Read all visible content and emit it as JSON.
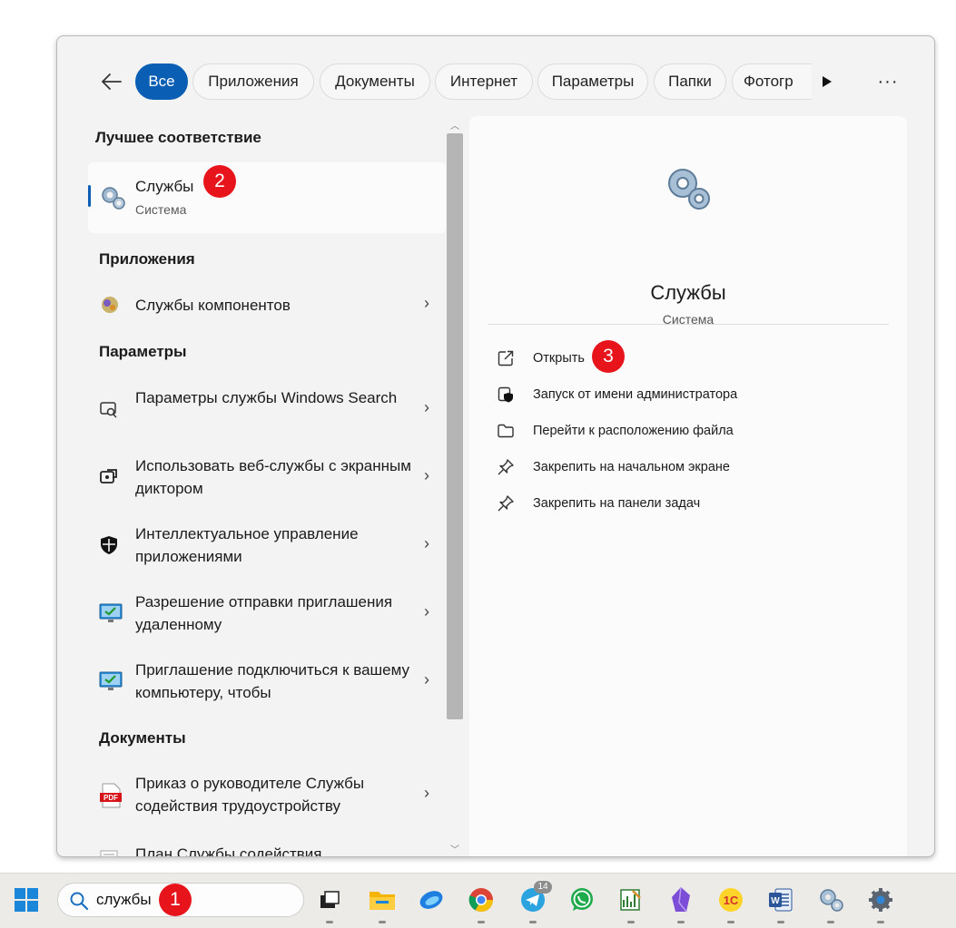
{
  "tabs": [
    "Все",
    "Приложения",
    "Документы",
    "Интернет",
    "Параметры",
    "Папки",
    "Фотогр"
  ],
  "more_label": "···",
  "best_match": {
    "heading": "Лучшее соответствие",
    "title": "Службы",
    "subtitle": "Система"
  },
  "apps": {
    "heading": "Приложения",
    "items": [
      {
        "label": "Службы компонентов"
      }
    ]
  },
  "settings": {
    "heading": "Параметры",
    "items": [
      {
        "label": "Параметры службы Windows Search"
      },
      {
        "label": "Использовать веб-службы с экранным диктором"
      },
      {
        "label": "Интеллектуальное управление приложениями"
      },
      {
        "label": "Разрешение отправки приглашения удаленному"
      },
      {
        "label": "Приглашение подключиться к вашему компьютеру, чтобы"
      }
    ]
  },
  "documents": {
    "heading": "Документы",
    "items": [
      {
        "label": "Приказ о руководителе Службы содействия трудоустройству"
      },
      {
        "label": "План Службы содействия"
      }
    ]
  },
  "preview": {
    "title": "Службы",
    "subtitle": "Система",
    "actions": [
      {
        "label": "Открыть",
        "icon": "open-external-icon"
      },
      {
        "label": "Запуск от имени администратора",
        "icon": "run-as-admin-icon"
      },
      {
        "label": "Перейти к расположению файла",
        "icon": "folder-icon"
      },
      {
        "label": "Закрепить на начальном экране",
        "icon": "pin-icon"
      },
      {
        "label": "Закрепить на панели задач",
        "icon": "pin-icon"
      }
    ]
  },
  "badges": [
    "1",
    "2",
    "3"
  ],
  "taskbar": {
    "search_value": "службы",
    "telegram_count": "14",
    "apps": [
      "windows-start",
      "task-view",
      "file-explorer",
      "edge",
      "chrome",
      "telegram",
      "whatsapp",
      "spreadsheet-app",
      "obsidian",
      "1c",
      "word",
      "services",
      "settings"
    ]
  },
  "colors": {
    "accent": "#0a5fb4",
    "badge": "#e8141b",
    "panel_bg": "#f3f3f3"
  }
}
